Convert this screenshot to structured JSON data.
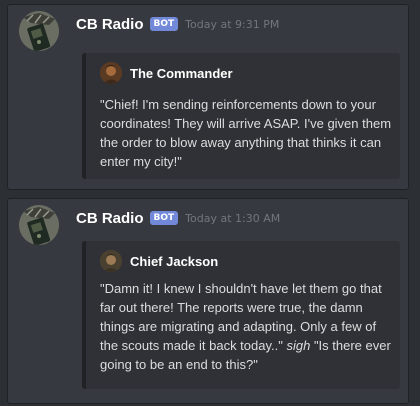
{
  "messages": [
    {
      "username": "CB Radio",
      "bot_tag": "BOT",
      "timestamp": "Today at 9:31 PM",
      "avatar_icon": "radio-icon",
      "embed": {
        "author_name": "The Commander",
        "author_icon": "commander-portrait-icon",
        "description": "\"Chief! I'm sending reinforcements down to your coordinates! They will arrive ASAP. I've given them the order to blow away anything that thinks it can enter my city!\""
      }
    },
    {
      "username": "CB Radio",
      "bot_tag": "BOT",
      "timestamp": "Today at 1:30 AM",
      "avatar_icon": "radio-icon",
      "embed": {
        "author_name": "Chief Jackson",
        "author_icon": "chief-portrait-icon",
        "description_part1": "\"Damn it! I knew I shouldn't have let them go that far out there! The reports were true, the damn things are migrating and adapting. Only a few of the scouts made it back today..\" ",
        "description_italic": "sigh",
        "description_part2": " \"Is there ever going to be an end to this?\""
      }
    }
  ],
  "colors": {
    "background": "#2c2f33",
    "message_bg": "#36393f",
    "embed_bg": "#2f3136",
    "bot_tag": "#7289da",
    "timestamp": "#72767d"
  }
}
